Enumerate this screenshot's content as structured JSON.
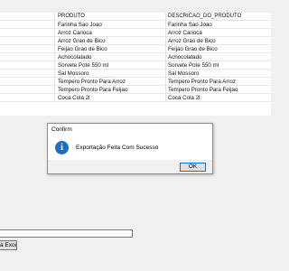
{
  "grid": {
    "columns": [
      "PRODUTO",
      "DESCRICAO_DO_PRODUTO"
    ],
    "rows": [
      [
        "Farinha Sao Joao",
        "Farinha Sao Joao"
      ],
      [
        "Arroz Carioca",
        "Arroz Carioca"
      ],
      [
        "Arroz Grao de Bico",
        "Arroz Grao de Bico"
      ],
      [
        "Feijao Grao de Bico",
        "Feijao Grao de Bico"
      ],
      [
        "Achocolatado",
        "Achocolatado"
      ],
      [
        "Sorvete Pote 550 ml",
        "Sorvete Pote 550 ml"
      ],
      [
        "Sal Mossoro",
        "Sal Mossoro"
      ],
      [
        "Tempero Pronto Para Arroz",
        "Tempero Pronto Para Arroz"
      ],
      [
        "Tempero Pronto Para Feijao",
        "Tempero Pronto Para Feijao"
      ],
      [
        "Coca Cola 2l",
        "Coca Cola 2l"
      ]
    ]
  },
  "dialog": {
    "title": "Confirm",
    "icon": "info-icon",
    "icon_glyph": "i",
    "message": "Exportação Feita Com Sucesso",
    "ok_label": "OK"
  },
  "form": {
    "input_value": "",
    "excel_button_label": "a Excel"
  },
  "colors": {
    "accent": "#0078d7",
    "info_icon": "#1d6fc4"
  }
}
